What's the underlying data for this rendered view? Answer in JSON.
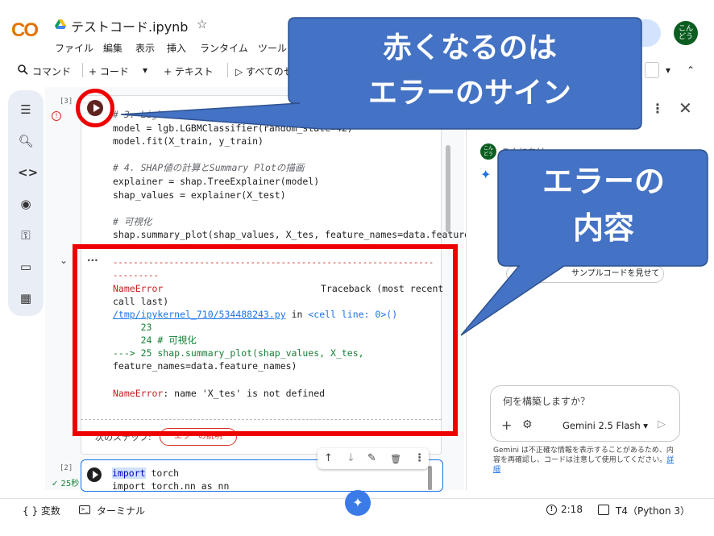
{
  "header": {
    "logo": "CO",
    "title": "テストコード.ipynb",
    "star": "☆",
    "menu": [
      "ファイル",
      "編集",
      "表示",
      "挿入",
      "ランタイム",
      "ツール"
    ],
    "avatar_line1": "こん",
    "avatar_line2": "どう"
  },
  "toolbar": {
    "command": "コマンド",
    "code": "+ コード",
    "dropdown": "▾",
    "text": "+ テキスト",
    "run_all": "▷ すべてのセ"
  },
  "cell1": {
    "exec_count": "[3]",
    "error_mark": "!",
    "lines": [
      {
        "t": "# 3. LightGBMモデルの学習（例として分類）",
        "c": true
      },
      {
        "t": "model = lgb.LGBMClassifier(random_state=42)",
        "c": false
      },
      {
        "t": "model.fit(X_train, y_train)",
        "c": false
      },
      {
        "t": "",
        "c": false
      },
      {
        "t": "# 4. SHAP値の計算とSummary Plotの描画",
        "c": true
      },
      {
        "t": "explainer = shap.TreeExplainer(model)",
        "c": false
      },
      {
        "t": "shap_values = explainer(X_test)",
        "c": false
      },
      {
        "t": "",
        "c": false
      },
      {
        "t": "# 可視化",
        "c": true
      },
      {
        "t": "shap.summary_plot(shap_values, X_tes, feature_names=data.feature",
        "c": false
      }
    ]
  },
  "output": {
    "chevron": "⌄",
    "dots": "···",
    "dashes1": "---------------------------------------------------------------",
    "dashes2": "---------",
    "error_name": "NameError",
    "traceback": "Traceback (most recent",
    "call_last": "call last)",
    "file_link": "/tmp/ipykernel_710/534488243.py",
    "in_word": " in ",
    "cell_line": "<cell line: 0>()",
    "line23": "     23",
    "line24": "     24 # 可視化",
    "line25": "---> 25 shap.summary_plot(shap_values, X_tes,",
    "line25b": "feature_names=data.feature_names)",
    "final_error_name": "NameError",
    "final_error_msg": ": name 'X_tes' is not defined",
    "next_steps": "次のステップ:",
    "explain_btn": "エラーの説明"
  },
  "cell2": {
    "exec_count": "[2]",
    "status": "✓ 25秒",
    "line1_kw": "import",
    "line1_rest": " torch",
    "line2": "import torch.nn as nn"
  },
  "cell_tools": [
    "↑",
    "↓",
    "✎",
    "🗑",
    "⋮"
  ],
  "gemini_panel": {
    "greeting": "こんにちは",
    "sample_chip": "サンプルコードを見せて",
    "prompt_placeholder": "何を構築しますか？",
    "plus": "+",
    "tune": "⚙",
    "model": "Gemini 2.5 Flash ▾",
    "send": "▷",
    "disclaimer": "Gemini は不正確な情報を表示することがあるため、内容を再確認し、コードは注意して使用してください。",
    "disclaimer_link": "詳細"
  },
  "statusbar": {
    "variables": "{ } 変数",
    "terminal": "ターミナル",
    "time": "2:18",
    "runtime": "T4（Python 3）"
  },
  "callouts": {
    "c1_line1": "赤くなるのは",
    "c1_line2": "エラーのサイン",
    "c2_line1": "エラーの",
    "c2_line2": "内容"
  },
  "colors": {
    "highlight_red": "#ee0000",
    "callout_blue": "#4472c4",
    "error_red": "#c5221f",
    "link_blue": "#1a73e8"
  }
}
